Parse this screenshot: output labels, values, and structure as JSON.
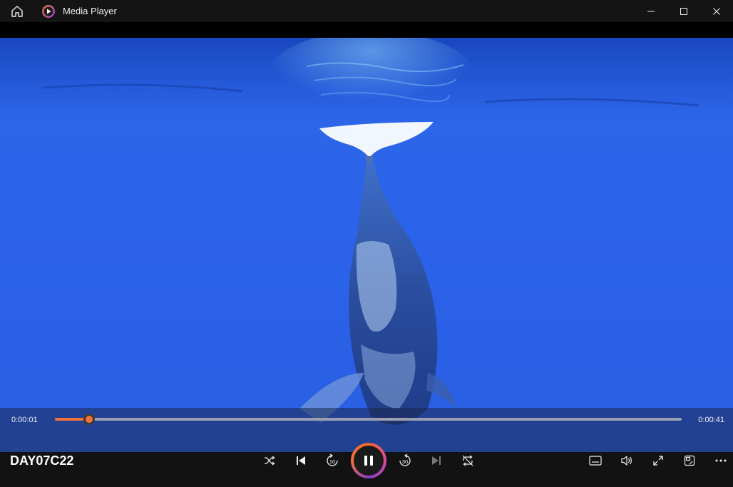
{
  "window": {
    "title": "Media Player"
  },
  "icons": {
    "home": "home-icon",
    "app": "media-player-app-icon",
    "minimize": "minimize-icon",
    "maximize": "maximize-icon",
    "close": "close-icon",
    "shuffle": "shuffle-icon",
    "previous": "previous-icon",
    "skip_back": "skip-back-10-icon",
    "pause": "pause-icon",
    "skip_forward": "skip-forward-30-icon",
    "next": "next-icon",
    "repeat": "repeat-icon",
    "subtitles": "subtitles-icon",
    "volume": "volume-icon",
    "fullscreen": "fullscreen-icon",
    "mini_view": "mini-view-icon",
    "more": "more-icon"
  },
  "playback": {
    "current_time": "0:00:01",
    "total_time": "0:00:41",
    "progress": 0.055,
    "skip_back_seconds": "10",
    "skip_forward_seconds": "30"
  },
  "media": {
    "title": "DAY07C22"
  },
  "colors": {
    "accent": "#f0733a",
    "water": "#2b63ea",
    "background": "#121212"
  }
}
